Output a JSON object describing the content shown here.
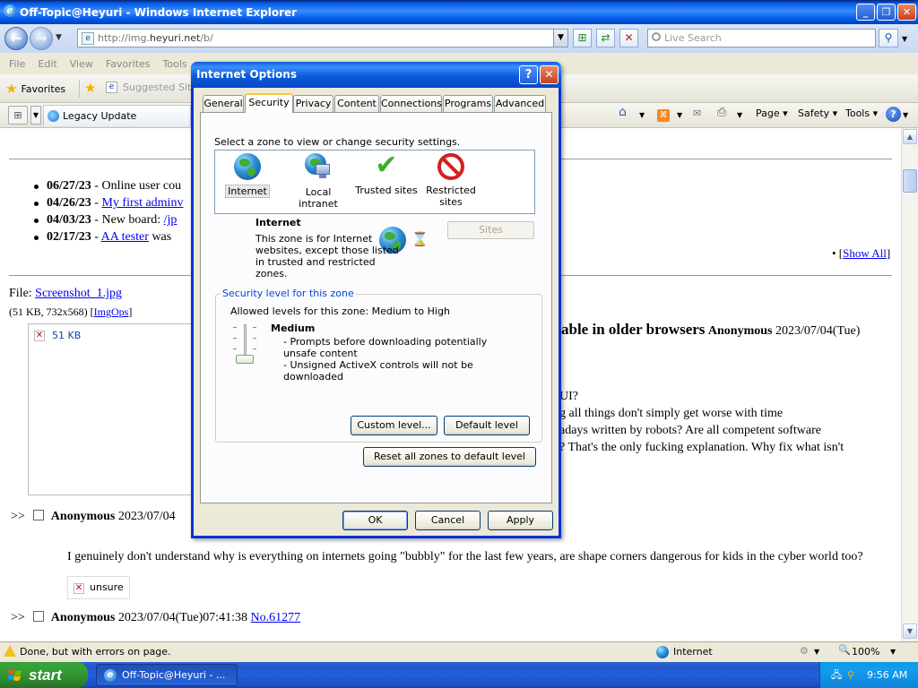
{
  "window": {
    "title": "Off-Topic@Heyuri - Windows Internet Explorer"
  },
  "nav": {
    "url_prefix": "http://img.",
    "url_domain": "heyuri.net",
    "url_path": "/b/",
    "search_placeholder": "Live Search"
  },
  "menu": [
    "File",
    "Edit",
    "View",
    "Favorites",
    "Tools"
  ],
  "favbar": {
    "favorites": "Favorites",
    "suggested": "Suggested Sites"
  },
  "cmdbar": {
    "legacy": "Legacy Update",
    "page": "Page",
    "safety": "Safety",
    "tools": "Tools"
  },
  "page": {
    "news": [
      {
        "date": "06/27/23",
        "sep": " - ",
        "text": "Online user cou"
      },
      {
        "date": "04/26/23",
        "sep": " - ",
        "link": "My first adminv"
      },
      {
        "date": "04/03/23",
        "sep": " - ",
        "text": "New board: ",
        "link": "/jp"
      },
      {
        "date": "02/17/23",
        "sep": " - ",
        "link": "AA tester",
        "text": " was "
      }
    ],
    "show_all": "Show All",
    "file_label": "File: ",
    "file_link": "Screenshot_1.jpg",
    "file_meta": "(51 KB, 732x568) ",
    "imgops": "ImgOps",
    "thumb_alt": "51 KB",
    "op_subject": "able in older browsers",
    "op_name": "Anonymous",
    "op_date": "2023/07/04(Tue)",
    "op_lines": [
      "UI?",
      "g all things don't simply get worse with time",
      "adays written by robots? Are all competent software",
      "? That's the only fucking explanation. Why fix what isn't"
    ],
    "reply1": {
      "arrows": ">>",
      "name": "Anonymous",
      "date": "2023/07/04",
      "text": "I genuinely don't understand why is everything on internets going \"bubbly\" for the last few years, are shape corners dangerous for kids in the cyber world too?",
      "img_alt": "unsure"
    },
    "reply2": {
      "arrows": ">>",
      "name": "Anonymous",
      "date": "2023/07/04(Tue)07:41:38",
      "no": "No.61277"
    }
  },
  "dialog": {
    "title": "Internet Options",
    "tabs": [
      "General",
      "Security",
      "Privacy",
      "Content",
      "Connections",
      "Programs",
      "Advanced"
    ],
    "zone_prompt": "Select a zone to view or change security settings.",
    "zones": [
      "Internet",
      "Local intranet",
      "Trusted sites",
      "Restricted sites"
    ],
    "zone_name": "Internet",
    "zone_desc": "This zone is for Internet websites, except those listed in trusted and restricted zones.",
    "sites_btn": "Sites",
    "group_title": "Security level for this zone",
    "allowed": "Allowed levels for this zone: Medium to High",
    "level": "Medium",
    "bullet1": "- Prompts before downloading potentially unsafe content",
    "bullet2": "- Unsigned ActiveX controls will not be downloaded",
    "custom_btn": "Custom level...",
    "default_btn": "Default level",
    "reset_btn": "Reset all zones to default level",
    "ok": "OK",
    "cancel": "Cancel",
    "apply": "Apply"
  },
  "status": {
    "text": "Done, but with errors on page.",
    "zone": "Internet",
    "zoom": "100%"
  },
  "taskbar": {
    "start": "start",
    "task": "Off-Topic@Heyuri - ...",
    "time": "9:56 AM"
  }
}
